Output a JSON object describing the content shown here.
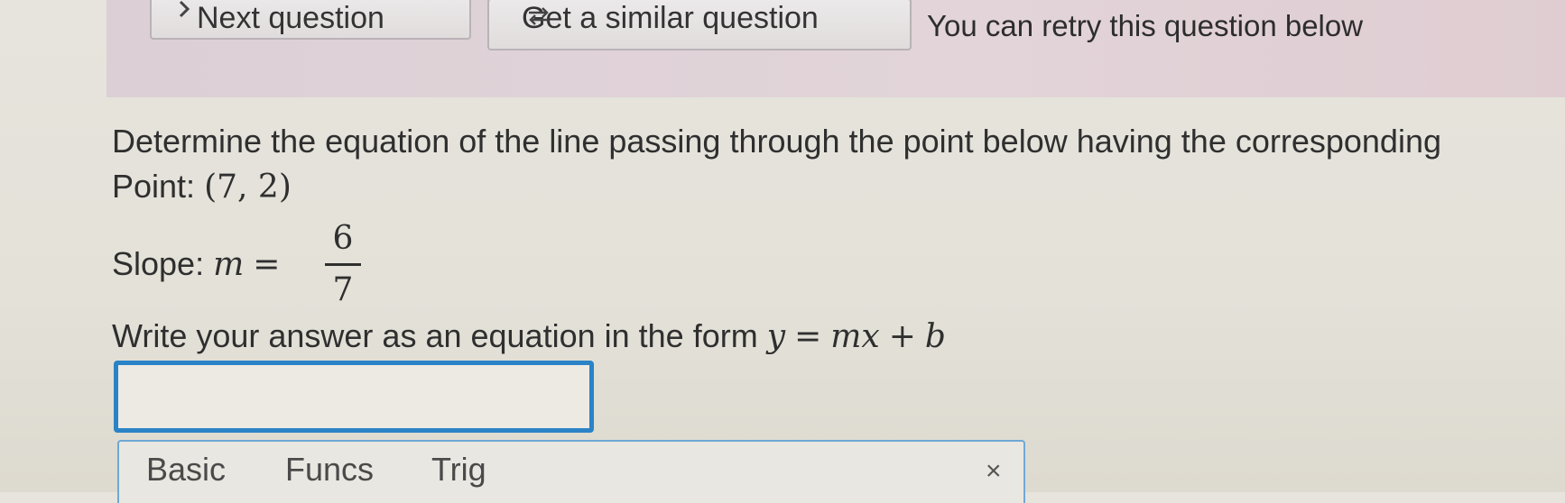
{
  "banner": {
    "next_label": "Next question",
    "similar_label": "Get a similar question",
    "retry_text": "You can retry this question below"
  },
  "question": {
    "prompt": "Determine the equation of the line passing through the point below having the corresponding",
    "point_label": "Point:",
    "point_value": "(7, 2)",
    "slope_label": "Slope:",
    "slope_var": "m",
    "slope_eq": "=",
    "slope_num": "6",
    "slope_den": "7",
    "instruction": "Write your answer as an equation in the form",
    "form_y": "y",
    "form_eq": "=",
    "form_mx": "mx",
    "form_plus": "+",
    "form_b": "b"
  },
  "answer": {
    "value": ""
  },
  "keypad": {
    "tabs": [
      "Basic",
      "Funcs",
      "Trig"
    ],
    "close_symbol": "×"
  },
  "colors": {
    "accent": "#2a83c6",
    "banner": "#e2d4d9"
  }
}
